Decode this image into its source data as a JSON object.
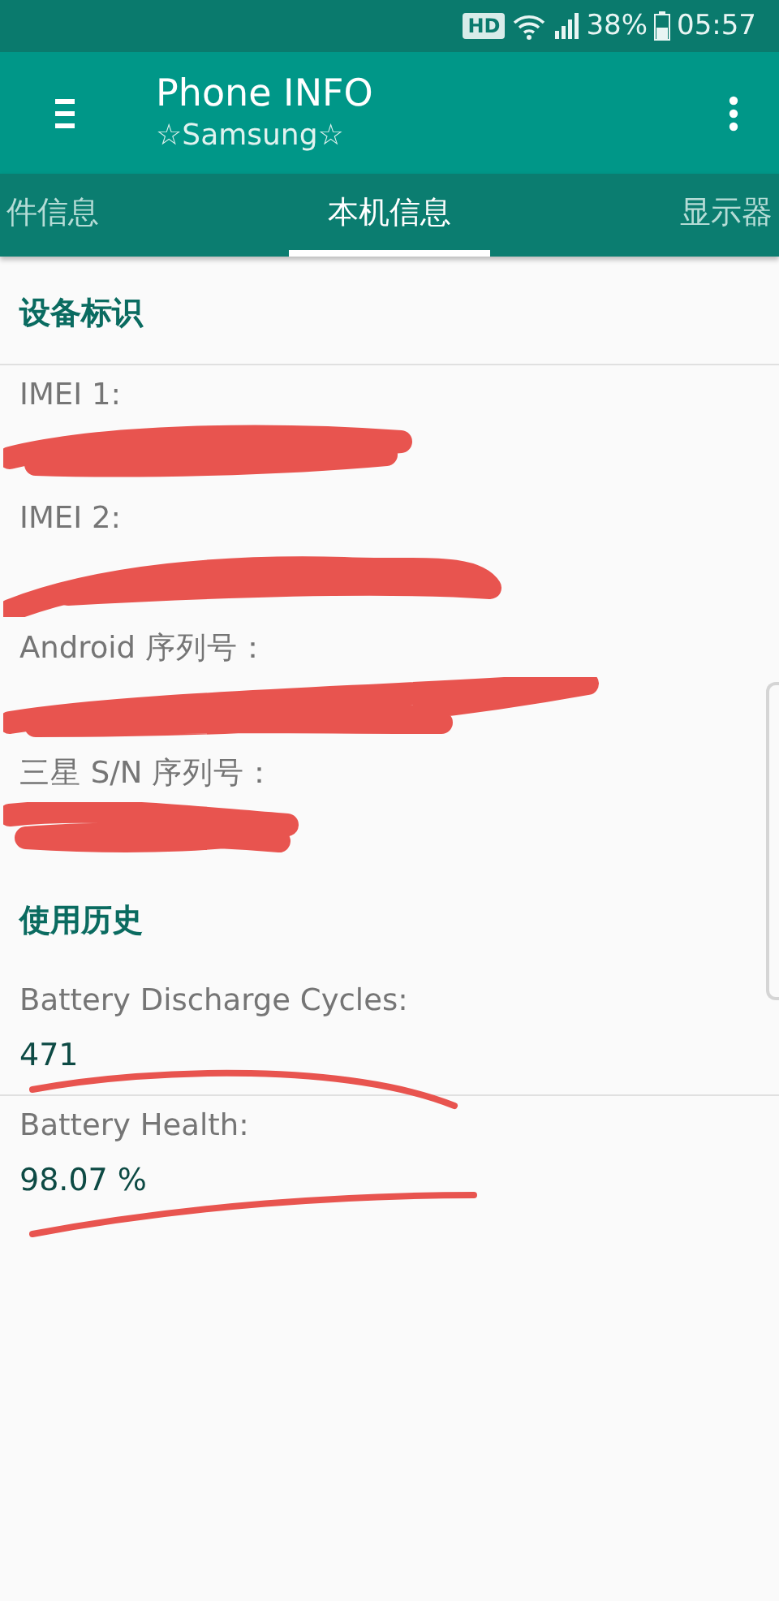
{
  "status_bar": {
    "hd_badge": "HD",
    "battery_percent": "38%",
    "time": "05:57"
  },
  "app_bar": {
    "title": "Phone INFO",
    "subtitle": "☆Samsung☆"
  },
  "tabs": [
    {
      "label": "件信息",
      "selected": false
    },
    {
      "label": "本机信息",
      "selected": true
    },
    {
      "label": "显示器",
      "selected": false
    }
  ],
  "sections": [
    {
      "title": "设备标识",
      "items": [
        {
          "label": "IMEI 1:",
          "kind": "redacted"
        },
        {
          "label": "IMEI 2:",
          "kind": "redacted"
        },
        {
          "label": "Android 序列号：",
          "kind": "redacted"
        },
        {
          "label": "三星 S/N 序列号：",
          "kind": "redacted"
        }
      ]
    },
    {
      "title": "使用历史",
      "items": [
        {
          "label": "Battery Discharge Cycles:",
          "kind": "value",
          "value": "471"
        },
        {
          "label": "Battery Health:",
          "kind": "value",
          "value": "98.07 %"
        }
      ]
    }
  ]
}
